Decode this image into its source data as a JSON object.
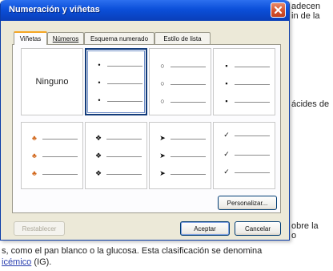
{
  "document": {
    "right_snippets": [
      "adecen",
      "in de la",
      "ácides de",
      "obre la",
      "o"
    ],
    "bottom_line1": "s, como el pan blanco o la glucosa. Esta clasificación se denomina",
    "bottom_line2_link": "icémico",
    "bottom_line2_rest": " (IG)."
  },
  "dialog": {
    "title": "Numeración y viñetas",
    "tabs": [
      {
        "label": "Viñetas"
      },
      {
        "label": "Números"
      },
      {
        "label": "Esquema numerado"
      },
      {
        "label": "Estilo de lista"
      }
    ],
    "cells": [
      {
        "label": "Ninguno"
      },
      {
        "bullet": "•"
      },
      {
        "bullet": "○"
      },
      {
        "bullet": "▪"
      },
      {
        "bullet": "♣"
      },
      {
        "bullet": "❖"
      },
      {
        "bullet": "➤"
      },
      {
        "bullet": "✓"
      }
    ],
    "buttons": {
      "customize": "Personalizar...",
      "reset": "Restablecer",
      "accept": "Aceptar",
      "cancel": "Cancelar"
    }
  },
  "colors": {
    "titlebar": "#0b4fd9",
    "dialog_bg": "#ece9d8",
    "active_tab_accent": "#f5a623",
    "selection_border": "#123b7a",
    "orange_bullet": "#d2691e"
  },
  "icons": {
    "close": "close-icon"
  }
}
